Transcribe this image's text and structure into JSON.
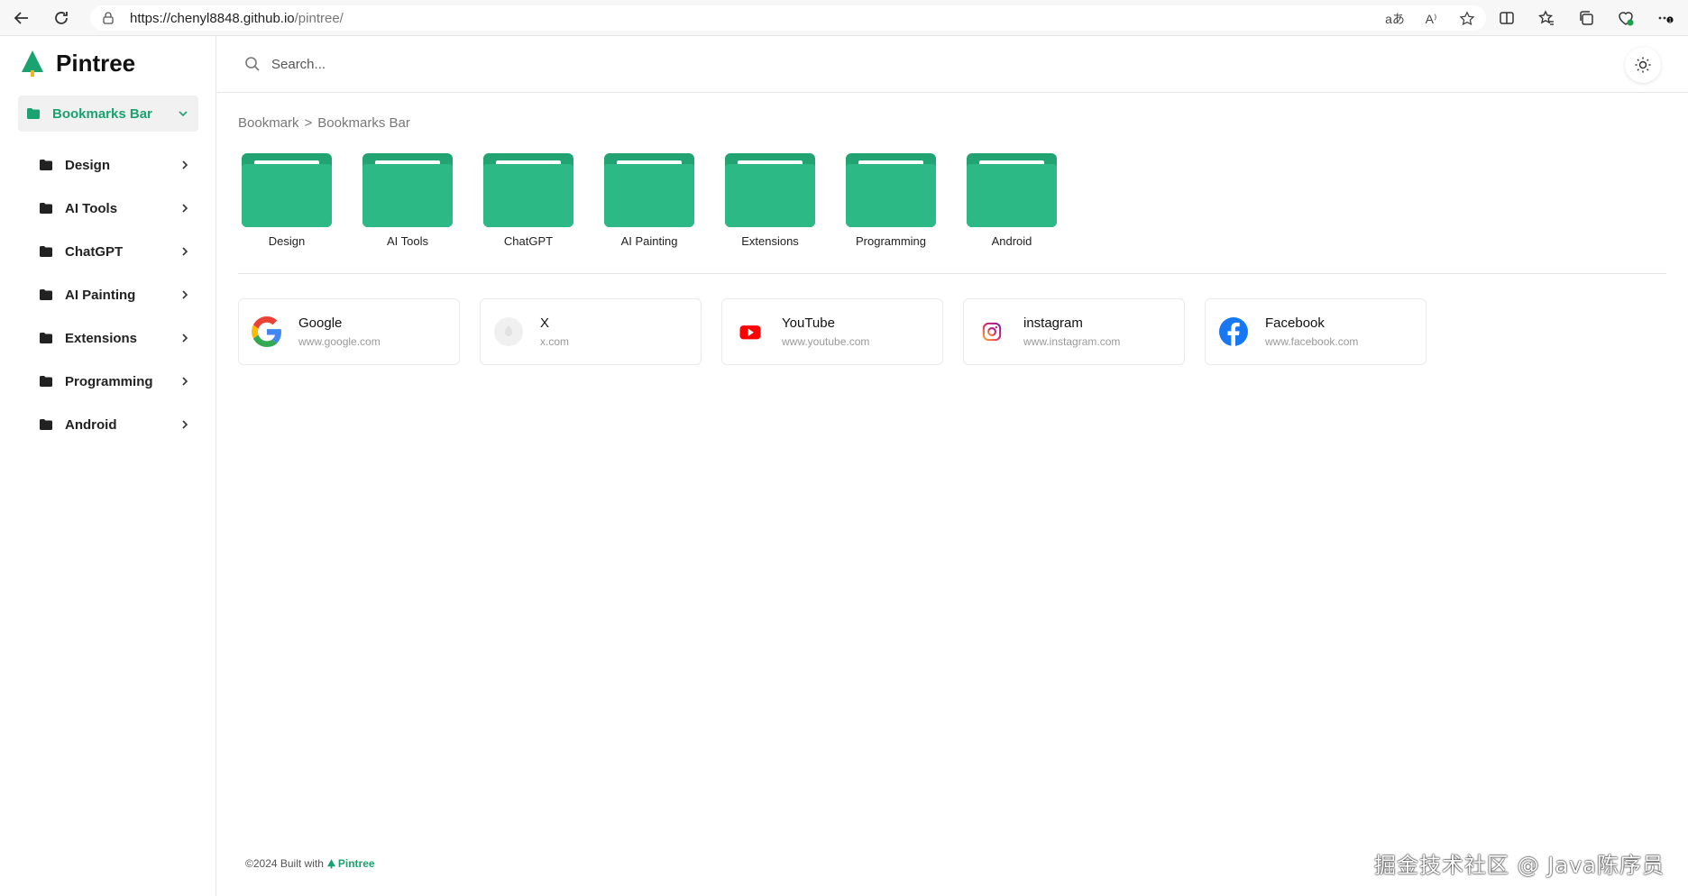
{
  "browser": {
    "url_host": "https://chenyl8848.github.io",
    "url_path": "/pintree/",
    "read_aloud": "A⁾",
    "translate": "aあ"
  },
  "sidebar": {
    "logo_text": "Pintree",
    "bookmarks_bar": "Bookmarks Bar",
    "items": [
      {
        "label": "Design"
      },
      {
        "label": "AI Tools"
      },
      {
        "label": "ChatGPT"
      },
      {
        "label": "AI Painting"
      },
      {
        "label": "Extensions"
      },
      {
        "label": "Programming"
      },
      {
        "label": "Android"
      }
    ]
  },
  "header": {
    "search_placeholder": "Search..."
  },
  "breadcrumb": {
    "root": "Bookmark",
    "separator": ">",
    "current": "Bookmarks Bar"
  },
  "folders": [
    {
      "label": "Design"
    },
    {
      "label": "AI Tools"
    },
    {
      "label": "ChatGPT"
    },
    {
      "label": "AI Painting"
    },
    {
      "label": "Extensions"
    },
    {
      "label": "Programming"
    },
    {
      "label": "Android"
    }
  ],
  "links": [
    {
      "title": "Google",
      "url": "www.google.com",
      "icon": "google-icon"
    },
    {
      "title": "X",
      "url": "x.com",
      "icon": "x-placeholder-icon"
    },
    {
      "title": "YouTube",
      "url": "www.youtube.com",
      "icon": "youtube-icon"
    },
    {
      "title": "instagram",
      "url": "www.instagram.com",
      "icon": "instagram-icon"
    },
    {
      "title": "Facebook",
      "url": "www.facebook.com",
      "icon": "facebook-icon"
    }
  ],
  "footer": {
    "text": "©2024 Built with",
    "brand": "Pintree"
  },
  "watermark": "掘金技术社区 @ Java陈序员",
  "colors": {
    "accent": "#1aa270",
    "folder": "#2cb985",
    "folder_dark": "#21a372"
  }
}
